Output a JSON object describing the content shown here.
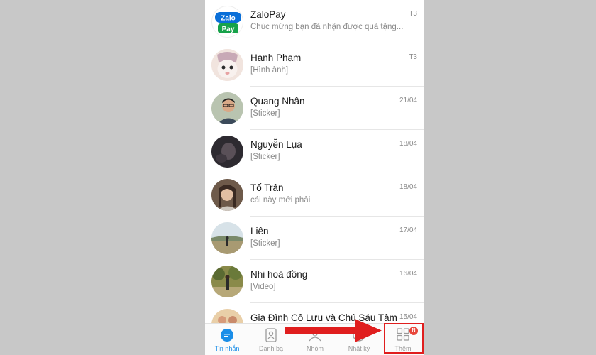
{
  "conversations": [
    {
      "name": "ZaloPay",
      "preview": "Chúc mừng bạn đã nhận được quà tặng...",
      "time": "T3"
    },
    {
      "name": "Hạnh Phạm",
      "preview": "[Hình ảnh]",
      "time": "T3"
    },
    {
      "name": "Quang Nhân",
      "preview": "[Sticker]",
      "time": "21/04"
    },
    {
      "name": "Nguyễn Lụa",
      "preview": "[Sticker]",
      "time": "18/04"
    },
    {
      "name": "Tố Trân",
      "preview": "cái này mới phải",
      "time": "18/04"
    },
    {
      "name": "Liên",
      "preview": "[Sticker]",
      "time": "17/04"
    },
    {
      "name": "Nhi hoà đồng",
      "preview": "[Video]",
      "time": "16/04"
    },
    {
      "name": "Gia Đình Cô Lựu và Chú Sáu Tâm",
      "preview": "",
      "time": "15/04"
    }
  ],
  "zalopay_logo": {
    "line1": "Zalo",
    "line2": "Pay"
  },
  "tabs": [
    {
      "label": "Tin nhắn",
      "icon": "chat-bubble-icon",
      "active": true
    },
    {
      "label": "Danh bạ",
      "icon": "contacts-icon",
      "active": false
    },
    {
      "label": "Nhóm",
      "icon": "group-icon",
      "active": false
    },
    {
      "label": "Nhật ký",
      "icon": "clock-icon",
      "active": false
    },
    {
      "label": "Thêm",
      "icon": "grid-icon",
      "active": false
    }
  ],
  "more_badge": "N",
  "colors": {
    "accent": "#1a8ee8",
    "highlight": "#e01e1e",
    "badge": "#e8463b",
    "background": "#c8c8c8"
  }
}
